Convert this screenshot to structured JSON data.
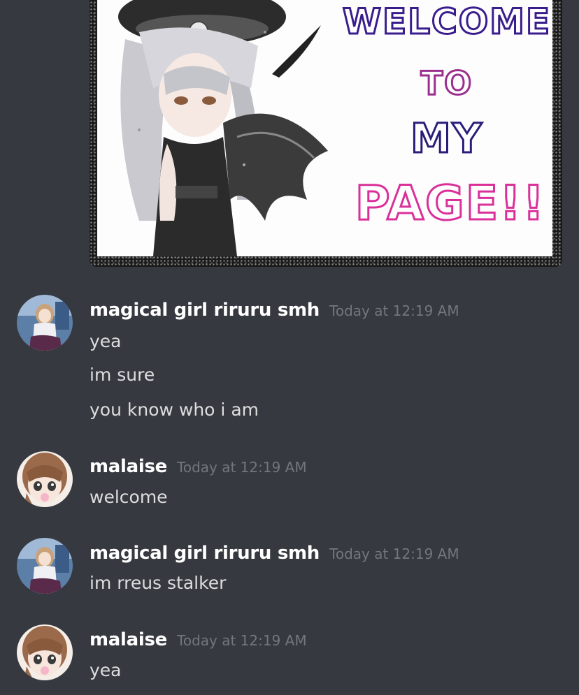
{
  "embed": {
    "image_lines": [
      "WELCOME",
      "TO",
      "MY",
      "PAGE!!"
    ],
    "colors": {
      "welcome": "#3a1d8c",
      "to": "#9b2f8f",
      "my": "#2a1d7a",
      "page": "#d9309a"
    }
  },
  "messages": [
    {
      "username": "magical girl riruru smh",
      "timestamp": "Today at 12:19 AM",
      "avatar": "riruru-avatar",
      "lines": [
        "yea",
        "im sure",
        "you know who i am"
      ]
    },
    {
      "username": "malaise",
      "timestamp": "Today at 12:19 AM",
      "avatar": "malaise-avatar",
      "lines": [
        "welcome"
      ]
    },
    {
      "username": "magical girl riruru smh",
      "timestamp": "Today at 12:19 AM",
      "avatar": "riruru-avatar",
      "lines": [
        "im rreus stalker"
      ]
    },
    {
      "username": "malaise",
      "timestamp": "Today at 12:19 AM",
      "avatar": "malaise-avatar",
      "lines": [
        "yea"
      ]
    }
  ],
  "theme": {
    "background": "#36393f",
    "username": "#ffffff",
    "timestamp": "#72767d",
    "message_text": "#dcddde"
  }
}
